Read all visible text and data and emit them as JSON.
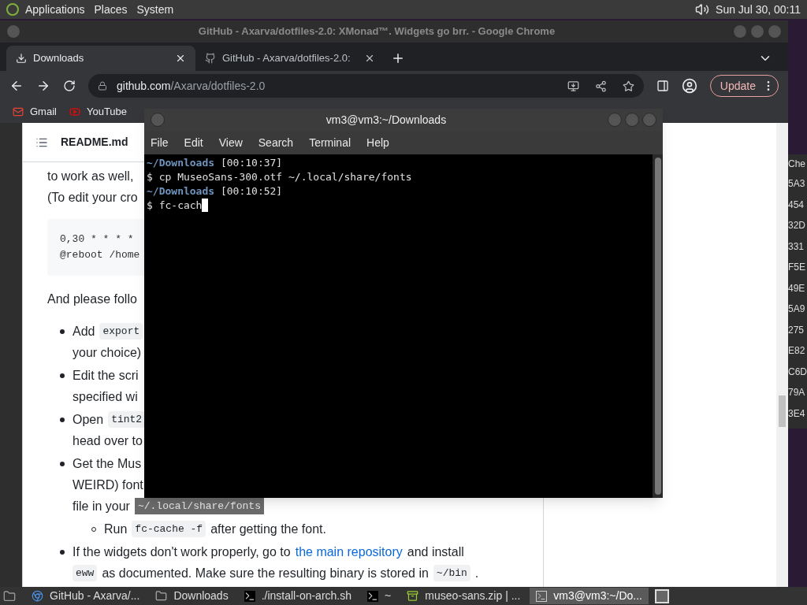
{
  "top_panel": {
    "menus": [
      "Applications",
      "Places",
      "System"
    ],
    "clock": "Sun Jul 30, 00:11"
  },
  "browser": {
    "title": "GitHub - Axarva/dotfiles-2.0: XMonad™. Widgets go brr. - Google Chrome",
    "tabs": [
      {
        "label": "Downloads",
        "kind": "download",
        "selected": true
      },
      {
        "label": "GitHub - Axarva/dotfiles-2.0:",
        "kind": "github",
        "selected": false
      }
    ],
    "url": {
      "host": "github.com",
      "path": "/Axarva/dotfiles-2.0"
    },
    "update_button": "Update",
    "bookmarks": [
      {
        "label": "Gmail",
        "kind": "gmail"
      },
      {
        "label": "YouTube",
        "kind": "youtube"
      }
    ],
    "readme": {
      "filename": "README.md",
      "blocks": [
        {
          "kind": "paragraph",
          "lines": [
            [
              {
                "kind": "text",
                "text": "to work as well,"
              }
            ],
            [
              {
                "kind": "text",
                "text": "(To edit your cro"
              }
            ]
          ]
        },
        {
          "kind": "code",
          "lines": [
            "0,30 * * * *",
            "@reboot /home"
          ]
        },
        {
          "kind": "paragraph",
          "lines": [
            [
              {
                "kind": "text",
                "text": "And please follo"
              }
            ]
          ]
        },
        {
          "kind": "bullet",
          "lines": [
            [
              {
                "kind": "text",
                "text": "Add"
              },
              {
                "kind": "code",
                "text": "export"
              }
            ],
            [
              {
                "kind": "text",
                "text": "your choice)"
              }
            ]
          ]
        },
        {
          "kind": "bullet",
          "lines": [
            [
              {
                "kind": "text",
                "text": "Edit the scri"
              }
            ],
            [
              {
                "kind": "text",
                "text": "specified wi"
              }
            ]
          ]
        },
        {
          "kind": "bullet",
          "lines": [
            [
              {
                "kind": "text",
                "text": "Open"
              },
              {
                "kind": "code",
                "text": "tint2"
              }
            ],
            [
              {
                "kind": "text",
                "text": "head over to"
              }
            ]
          ]
        },
        {
          "kind": "bullet",
          "lines": [
            [
              {
                "kind": "text",
                "text": "Get the Mus"
              }
            ],
            [
              {
                "kind": "text",
                "text": "WEIRD) font"
              }
            ],
            [
              {
                "kind": "text",
                "text": "file in your"
              },
              {
                "kind": "selected_code",
                "text": "~/.local/share/fonts"
              }
            ]
          ]
        },
        {
          "kind": "subbullet",
          "lines": [
            [
              {
                "kind": "text",
                "text": "Run"
              },
              {
                "kind": "code",
                "text": "fc-cache -f"
              },
              {
                "kind": "text",
                "text": "after getting the font."
              }
            ]
          ]
        },
        {
          "kind": "bullet",
          "lines": [
            [
              {
                "kind": "text",
                "text": "If the widgets don't work properly, go to"
              },
              {
                "kind": "link",
                "text": "the main repository"
              },
              {
                "kind": "text",
                "text": "and install"
              }
            ],
            [
              {
                "kind": "code",
                "text": "eww"
              },
              {
                "kind": "text",
                "text": "as documented. Make sure the resulting binary is stored in"
              },
              {
                "kind": "code",
                "text": "~/bin"
              },
              {
                "kind": "text",
                "text": "."
              }
            ]
          ]
        }
      ]
    }
  },
  "back_window": {
    "column_header": "Che",
    "cells": [
      "5A3",
      "454",
      "32D",
      "331",
      "F5E",
      "49E",
      "5A9",
      "275",
      "E82",
      "C6D",
      "79A",
      "3E4"
    ]
  },
  "terminal": {
    "title": "vm3@vm3:~/Downloads",
    "menus": [
      "File",
      "Edit",
      "View",
      "Search",
      "Terminal",
      "Help"
    ],
    "lines": [
      {
        "kind": "prompt",
        "path": "~/Downloads",
        "time": "[00:10:37]"
      },
      {
        "kind": "command",
        "sign": "$",
        "text": "cp MuseoSans-300.otf ~/.local/share/fonts",
        "cursor": false
      },
      {
        "kind": "prompt",
        "path": "~/Downloads",
        "time": "[00:10:52]"
      },
      {
        "kind": "command",
        "sign": "$",
        "text": "fc-cach",
        "cursor": true
      }
    ]
  },
  "taskbar": {
    "items": [
      {
        "label": "GitHub - Axarva/...",
        "kind": "chrome",
        "selected": false
      },
      {
        "label": "Downloads",
        "kind": "folder",
        "selected": false
      },
      {
        "label": "./install-on-arch.sh",
        "kind": "terminal",
        "selected": false
      },
      {
        "label": "~",
        "kind": "terminal",
        "selected": false
      },
      {
        "label": "museo-sans.zip | ...",
        "kind": "archive",
        "selected": false
      },
      {
        "label": "vm3@vm3:~/Do...",
        "kind": "terminal-window",
        "selected": true
      }
    ]
  }
}
